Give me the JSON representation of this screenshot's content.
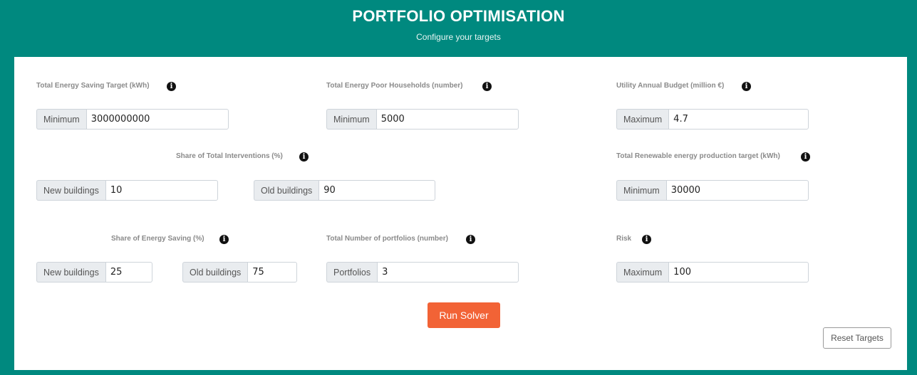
{
  "header": {
    "title": "PORTFOLIO OPTIMISATION",
    "subtitle": "Configure your targets"
  },
  "info_glyph": "i",
  "fields": {
    "energy_saving": {
      "label": "Total Energy Saving Target (kWh)",
      "addon": "Minimum",
      "value": "3000000000"
    },
    "energy_poor": {
      "label": "Total Energy Poor Households (number)",
      "addon": "Minimum",
      "value": "5000"
    },
    "budget": {
      "label": "Utility Annual Budget (million €)",
      "addon": "Maximum",
      "value": "4.7"
    },
    "interventions": {
      "label": "Share of Total Interventions (%)",
      "new_addon": "New buildings",
      "new_value": "10",
      "old_addon": "Old buildings",
      "old_value": "90"
    },
    "renewable": {
      "label": "Total Renewable energy production target (kWh)",
      "addon": "Minimum",
      "value": "30000"
    },
    "share_saving": {
      "label": "Share of Energy Saving (%)",
      "new_addon": "New buildings",
      "new_value": "25",
      "old_addon": "Old buildings",
      "old_value": "75"
    },
    "portfolios": {
      "label": "Total Number of portfolios (number)",
      "addon": "Portfolios",
      "value": "3"
    },
    "risk": {
      "label": "Risk",
      "addon": "Maximum",
      "value": "100"
    }
  },
  "buttons": {
    "run": "Run Solver",
    "reset": "Reset Targets"
  },
  "colors": {
    "header_bg": "#00897f",
    "run_button": "#f26336"
  }
}
